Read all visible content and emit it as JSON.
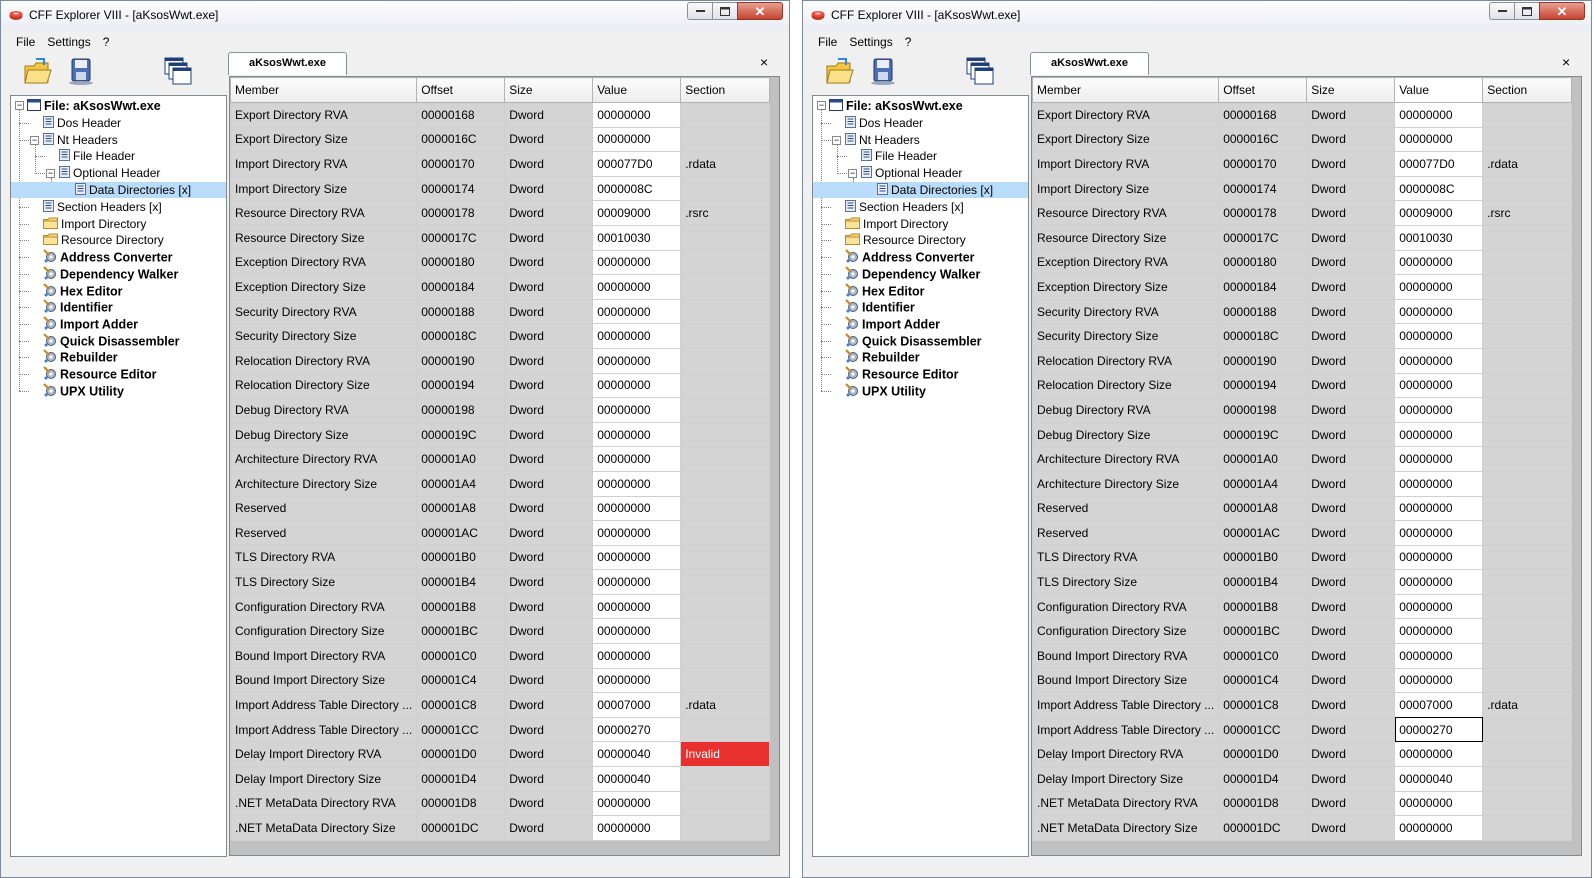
{
  "windows": {
    "left": {
      "title": "CFF Explorer VIII - [aKsosWwt.exe]",
      "menu": [
        "File",
        "Settings",
        "?"
      ],
      "tab_label": "aKsosWwt.exe",
      "tab_close": "×",
      "tree_root": "File: aKsosWwt.exe",
      "tree_items": [
        "Dos Header",
        "Nt Headers",
        "File Header",
        "Optional Header",
        "Data Directories [x]",
        "Section Headers [x]",
        "Import Directory",
        "Resource Directory",
        "Address Converter",
        "Dependency Walker",
        "Hex Editor",
        "Identifier",
        "Import Adder",
        "Quick Disassembler",
        "Rebuilder",
        "Resource Editor",
        "UPX Utility"
      ],
      "selected_tree_item": "Data Directories [x]",
      "columns": [
        "Member",
        "Offset",
        "Size",
        "Value",
        "Section"
      ],
      "rows": [
        {
          "member": "Export Directory RVA",
          "offset": "00000168",
          "size": "Dword",
          "value": "00000000",
          "section": ""
        },
        {
          "member": "Export Directory Size",
          "offset": "0000016C",
          "size": "Dword",
          "value": "00000000",
          "section": ""
        },
        {
          "member": "Import Directory RVA",
          "offset": "00000170",
          "size": "Dword",
          "value": "000077D0",
          "section": ".rdata"
        },
        {
          "member": "Import Directory Size",
          "offset": "00000174",
          "size": "Dword",
          "value": "0000008C",
          "section": ""
        },
        {
          "member": "Resource Directory RVA",
          "offset": "00000178",
          "size": "Dword",
          "value": "00009000",
          "section": ".rsrc"
        },
        {
          "member": "Resource Directory Size",
          "offset": "0000017C",
          "size": "Dword",
          "value": "00010030",
          "section": ""
        },
        {
          "member": "Exception Directory RVA",
          "offset": "00000180",
          "size": "Dword",
          "value": "00000000",
          "section": ""
        },
        {
          "member": "Exception Directory Size",
          "offset": "00000184",
          "size": "Dword",
          "value": "00000000",
          "section": ""
        },
        {
          "member": "Security Directory RVA",
          "offset": "00000188",
          "size": "Dword",
          "value": "00000000",
          "section": ""
        },
        {
          "member": "Security Directory Size",
          "offset": "0000018C",
          "size": "Dword",
          "value": "00000000",
          "section": ""
        },
        {
          "member": "Relocation Directory RVA",
          "offset": "00000190",
          "size": "Dword",
          "value": "00000000",
          "section": ""
        },
        {
          "member": "Relocation Directory Size",
          "offset": "00000194",
          "size": "Dword",
          "value": "00000000",
          "section": ""
        },
        {
          "member": "Debug Directory RVA",
          "offset": "00000198",
          "size": "Dword",
          "value": "00000000",
          "section": ""
        },
        {
          "member": "Debug Directory Size",
          "offset": "0000019C",
          "size": "Dword",
          "value": "00000000",
          "section": ""
        },
        {
          "member": "Architecture Directory RVA",
          "offset": "000001A0",
          "size": "Dword",
          "value": "00000000",
          "section": ""
        },
        {
          "member": "Architecture Directory Size",
          "offset": "000001A4",
          "size": "Dword",
          "value": "00000000",
          "section": ""
        },
        {
          "member": "Reserved",
          "offset": "000001A8",
          "size": "Dword",
          "value": "00000000",
          "section": ""
        },
        {
          "member": "Reserved",
          "offset": "000001AC",
          "size": "Dword",
          "value": "00000000",
          "section": ""
        },
        {
          "member": "TLS Directory RVA",
          "offset": "000001B0",
          "size": "Dword",
          "value": "00000000",
          "section": ""
        },
        {
          "member": "TLS Directory Size",
          "offset": "000001B4",
          "size": "Dword",
          "value": "00000000",
          "section": ""
        },
        {
          "member": "Configuration Directory RVA",
          "offset": "000001B8",
          "size": "Dword",
          "value": "00000000",
          "section": ""
        },
        {
          "member": "Configuration Directory Size",
          "offset": "000001BC",
          "size": "Dword",
          "value": "00000000",
          "section": ""
        },
        {
          "member": "Bound Import Directory RVA",
          "offset": "000001C0",
          "size": "Dword",
          "value": "00000000",
          "section": ""
        },
        {
          "member": "Bound Import Directory Size",
          "offset": "000001C4",
          "size": "Dword",
          "value": "00000000",
          "section": ""
        },
        {
          "member": "Import Address Table Directory ...",
          "offset": "000001C8",
          "size": "Dword",
          "value": "00007000",
          "section": ".rdata"
        },
        {
          "member": "Import Address Table Directory ...",
          "offset": "000001CC",
          "size": "Dword",
          "value": "00000270",
          "section": ""
        },
        {
          "member": "Delay Import Directory RVA",
          "offset": "000001D0",
          "size": "Dword",
          "value": "00000040",
          "section": "Invalid",
          "invalid": true
        },
        {
          "member": "Delay Import Directory Size",
          "offset": "000001D4",
          "size": "Dword",
          "value": "00000040",
          "section": ""
        },
        {
          "member": ".NET MetaData Directory RVA",
          "offset": "000001D8",
          "size": "Dword",
          "value": "00000000",
          "section": ""
        },
        {
          "member": ".NET MetaData Directory Size",
          "offset": "000001DC",
          "size": "Dword",
          "value": "00000000",
          "section": ""
        }
      ]
    },
    "right": {
      "title": "CFF Explorer VIII - [aKsosWwt.exe]",
      "menu": [
        "File",
        "Settings",
        "?"
      ],
      "tab_label": "aKsosWwt.exe",
      "tab_close": "×",
      "tree_root": "File: aKsosWwt.exe",
      "tree_items": [
        "Dos Header",
        "Nt Headers",
        "File Header",
        "Optional Header",
        "Data Directories [x]",
        "Section Headers [x]",
        "Import Directory",
        "Resource Directory",
        "Address Converter",
        "Dependency Walker",
        "Hex Editor",
        "Identifier",
        "Import Adder",
        "Quick Disassembler",
        "Rebuilder",
        "Resource Editor",
        "UPX Utility"
      ],
      "selected_tree_item": "Data Directories [x]",
      "columns": [
        "Member",
        "Offset",
        "Size",
        "Value",
        "Section"
      ],
      "rows": [
        {
          "member": "Export Directory RVA",
          "offset": "00000168",
          "size": "Dword",
          "value": "00000000",
          "section": ""
        },
        {
          "member": "Export Directory Size",
          "offset": "0000016C",
          "size": "Dword",
          "value": "00000000",
          "section": ""
        },
        {
          "member": "Import Directory RVA",
          "offset": "00000170",
          "size": "Dword",
          "value": "000077D0",
          "section": ".rdata"
        },
        {
          "member": "Import Directory Size",
          "offset": "00000174",
          "size": "Dword",
          "value": "0000008C",
          "section": ""
        },
        {
          "member": "Resource Directory RVA",
          "offset": "00000178",
          "size": "Dword",
          "value": "00009000",
          "section": ".rsrc"
        },
        {
          "member": "Resource Directory Size",
          "offset": "0000017C",
          "size": "Dword",
          "value": "00010030",
          "section": ""
        },
        {
          "member": "Exception Directory RVA",
          "offset": "00000180",
          "size": "Dword",
          "value": "00000000",
          "section": ""
        },
        {
          "member": "Exception Directory Size",
          "offset": "00000184",
          "size": "Dword",
          "value": "00000000",
          "section": ""
        },
        {
          "member": "Security Directory RVA",
          "offset": "00000188",
          "size": "Dword",
          "value": "00000000",
          "section": ""
        },
        {
          "member": "Security Directory Size",
          "offset": "0000018C",
          "size": "Dword",
          "value": "00000000",
          "section": ""
        },
        {
          "member": "Relocation Directory RVA",
          "offset": "00000190",
          "size": "Dword",
          "value": "00000000",
          "section": ""
        },
        {
          "member": "Relocation Directory Size",
          "offset": "00000194",
          "size": "Dword",
          "value": "00000000",
          "section": ""
        },
        {
          "member": "Debug Directory RVA",
          "offset": "00000198",
          "size": "Dword",
          "value": "00000000",
          "section": ""
        },
        {
          "member": "Debug Directory Size",
          "offset": "0000019C",
          "size": "Dword",
          "value": "00000000",
          "section": ""
        },
        {
          "member": "Architecture Directory RVA",
          "offset": "000001A0",
          "size": "Dword",
          "value": "00000000",
          "section": ""
        },
        {
          "member": "Architecture Directory Size",
          "offset": "000001A4",
          "size": "Dword",
          "value": "00000000",
          "section": ""
        },
        {
          "member": "Reserved",
          "offset": "000001A8",
          "size": "Dword",
          "value": "00000000",
          "section": ""
        },
        {
          "member": "Reserved",
          "offset": "000001AC",
          "size": "Dword",
          "value": "00000000",
          "section": ""
        },
        {
          "member": "TLS Directory RVA",
          "offset": "000001B0",
          "size": "Dword",
          "value": "00000000",
          "section": ""
        },
        {
          "member": "TLS Directory Size",
          "offset": "000001B4",
          "size": "Dword",
          "value": "00000000",
          "section": ""
        },
        {
          "member": "Configuration Directory RVA",
          "offset": "000001B8",
          "size": "Dword",
          "value": "00000000",
          "section": ""
        },
        {
          "member": "Configuration Directory Size",
          "offset": "000001BC",
          "size": "Dword",
          "value": "00000000",
          "section": ""
        },
        {
          "member": "Bound Import Directory RVA",
          "offset": "000001C0",
          "size": "Dword",
          "value": "00000000",
          "section": ""
        },
        {
          "member": "Bound Import Directory Size",
          "offset": "000001C4",
          "size": "Dword",
          "value": "00000000",
          "section": ""
        },
        {
          "member": "Import Address Table Directory ...",
          "offset": "000001C8",
          "size": "Dword",
          "value": "00007000",
          "section": ".rdata"
        },
        {
          "member": "Import Address Table Directory ...",
          "offset": "000001CC",
          "size": "Dword",
          "value": "00000270",
          "section": "",
          "focused": true
        },
        {
          "member": "Delay Import Directory RVA",
          "offset": "000001D0",
          "size": "Dword",
          "value": "00000000",
          "section": ""
        },
        {
          "member": "Delay Import Directory Size",
          "offset": "000001D4",
          "size": "Dword",
          "value": "00000040",
          "section": ""
        },
        {
          "member": ".NET MetaData Directory RVA",
          "offset": "000001D8",
          "size": "Dword",
          "value": "00000000",
          "section": ""
        },
        {
          "member": ".NET MetaData Directory Size",
          "offset": "000001DC",
          "size": "Dword",
          "value": "00000000",
          "section": ""
        }
      ]
    }
  },
  "icons": {
    "app": "cff-explorer-app-icon",
    "open": "open-file-icon",
    "save": "save-disk-icon",
    "windows": "cascade-windows-icon",
    "module": "module-node-icon",
    "folder": "folder-icon",
    "tool": "tool-gear-icon"
  },
  "colors": {
    "invalid_section": "#e8302f",
    "tree_selection": "#b9dcfb",
    "grid_gray": "#d4d4d4"
  }
}
